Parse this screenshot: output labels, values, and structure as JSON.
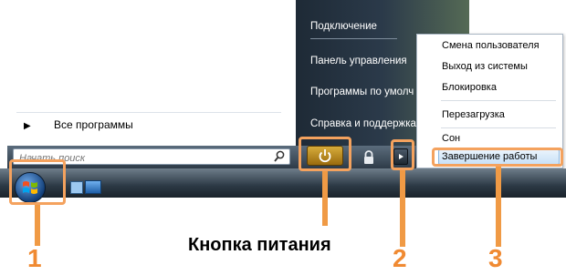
{
  "start_menu": {
    "all_programs": "Все программы",
    "search_placeholder": "Начать поиск",
    "right_items": [
      "Подключение",
      "Панель управления",
      "Программы по умолч",
      "Справка и поддержка"
    ]
  },
  "power_menu": {
    "items": [
      "Смена пользователя",
      "Выход из системы",
      "Блокировка",
      "Перезагрузка",
      "Сон",
      "Завершение работы"
    ],
    "highlighted": "Завершение работы"
  },
  "annotations": {
    "n1": "1",
    "n2": "2",
    "n3": "3",
    "caption": "Кнопка питания",
    "color": "#f08a32"
  },
  "icons": [
    "arrow-right-icon",
    "search-icon",
    "power-icon",
    "lock-icon",
    "chevron-right-icon",
    "windows-logo-icon"
  ]
}
